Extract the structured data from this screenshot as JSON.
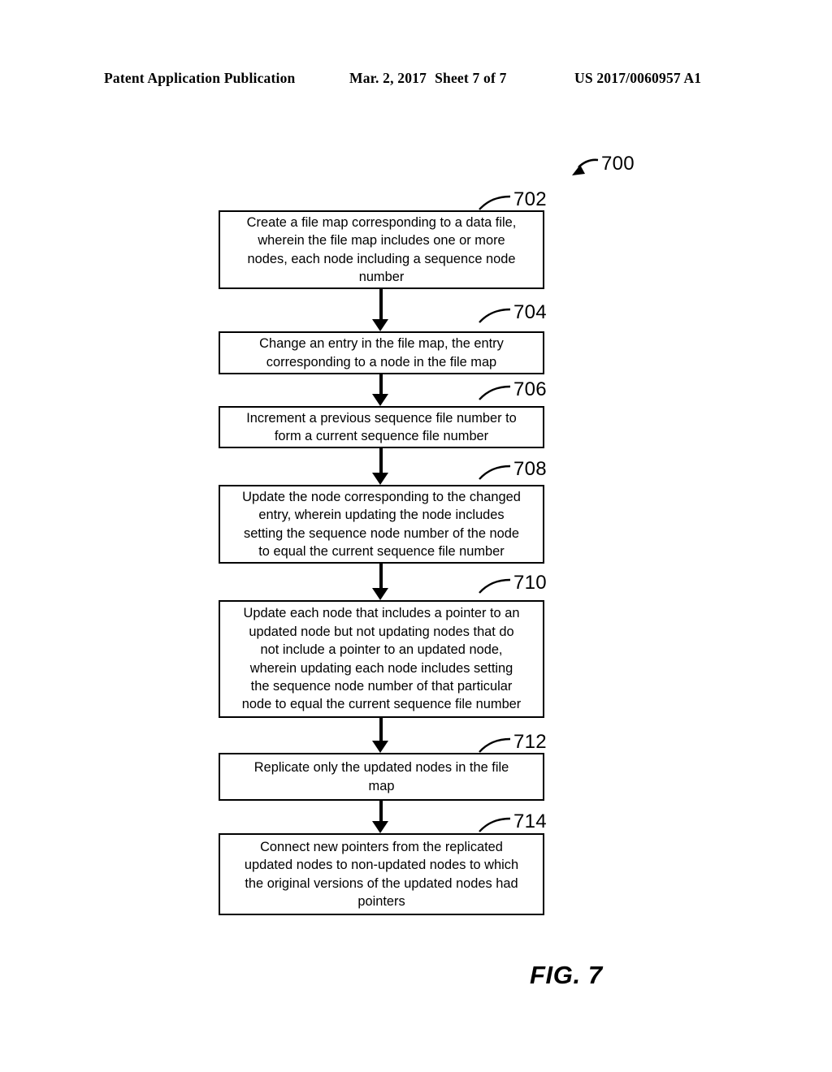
{
  "header": {
    "publication_label": "Patent Application Publication",
    "date": "Mar. 2, 2017",
    "sheet": "Sheet 7 of 7",
    "publication_number": "US 2017/0060957 A1"
  },
  "figure": {
    "caption": "FIG. 7",
    "diagram_numeral": "700",
    "type": "flowchart",
    "ink_color": "#000000",
    "background_color": "#ffffff"
  },
  "flowchart": {
    "steps": [
      {
        "numeral": "702",
        "text": "Create a file map corresponding to a data file, wherein the file map includes one or more nodes, each node including a sequence node number",
        "lines": [
          "Create a file map corresponding to a data file,",
          "wherein the file map includes one or more",
          "nodes, each node including a sequence node",
          "number"
        ]
      },
      {
        "numeral": "704",
        "text": "Change an entry in the file map, the entry corresponding to a node in the file map",
        "lines": [
          "Change an entry in the file map, the entry",
          "corresponding to a node in the file map"
        ]
      },
      {
        "numeral": "706",
        "text": "Increment a previous sequence file number to form a current sequence file number",
        "lines": [
          "Increment a previous sequence file number to",
          "form a current sequence file number"
        ]
      },
      {
        "numeral": "708",
        "text": "Update the node corresponding to the changed entry, wherein updating the node includes setting the sequence node number of the node to equal the current sequence file number",
        "lines": [
          "Update the node corresponding to the changed",
          "entry, wherein updating the node includes",
          "setting the sequence node number of the node",
          "to equal the current sequence file number"
        ]
      },
      {
        "numeral": "710",
        "text": "Update each node that includes a pointer to an updated node but not updating nodes that do not include a pointer to an updated node, wherein updating each node includes setting the sequence node number of that particular node to equal the current sequence file number",
        "lines": [
          "Update each node that includes a pointer to an",
          "updated node but not updating nodes that do",
          "not include a pointer to an updated node,",
          "wherein updating each node includes setting",
          "the sequence node number of that particular",
          "node to equal the current sequence file number"
        ]
      },
      {
        "numeral": "712",
        "text": "Replicate only the updated nodes in the file map",
        "lines": [
          "Replicate only the updated nodes in the file",
          "map"
        ]
      },
      {
        "numeral": "714",
        "text": "Connect new pointers from the replicated updated nodes to non-updated nodes to which the original versions of the updated nodes had pointers",
        "lines": [
          "Connect new pointers from the replicated",
          "updated nodes to non-updated nodes to which",
          "the original versions of the updated nodes had",
          "pointers"
        ]
      }
    ]
  }
}
